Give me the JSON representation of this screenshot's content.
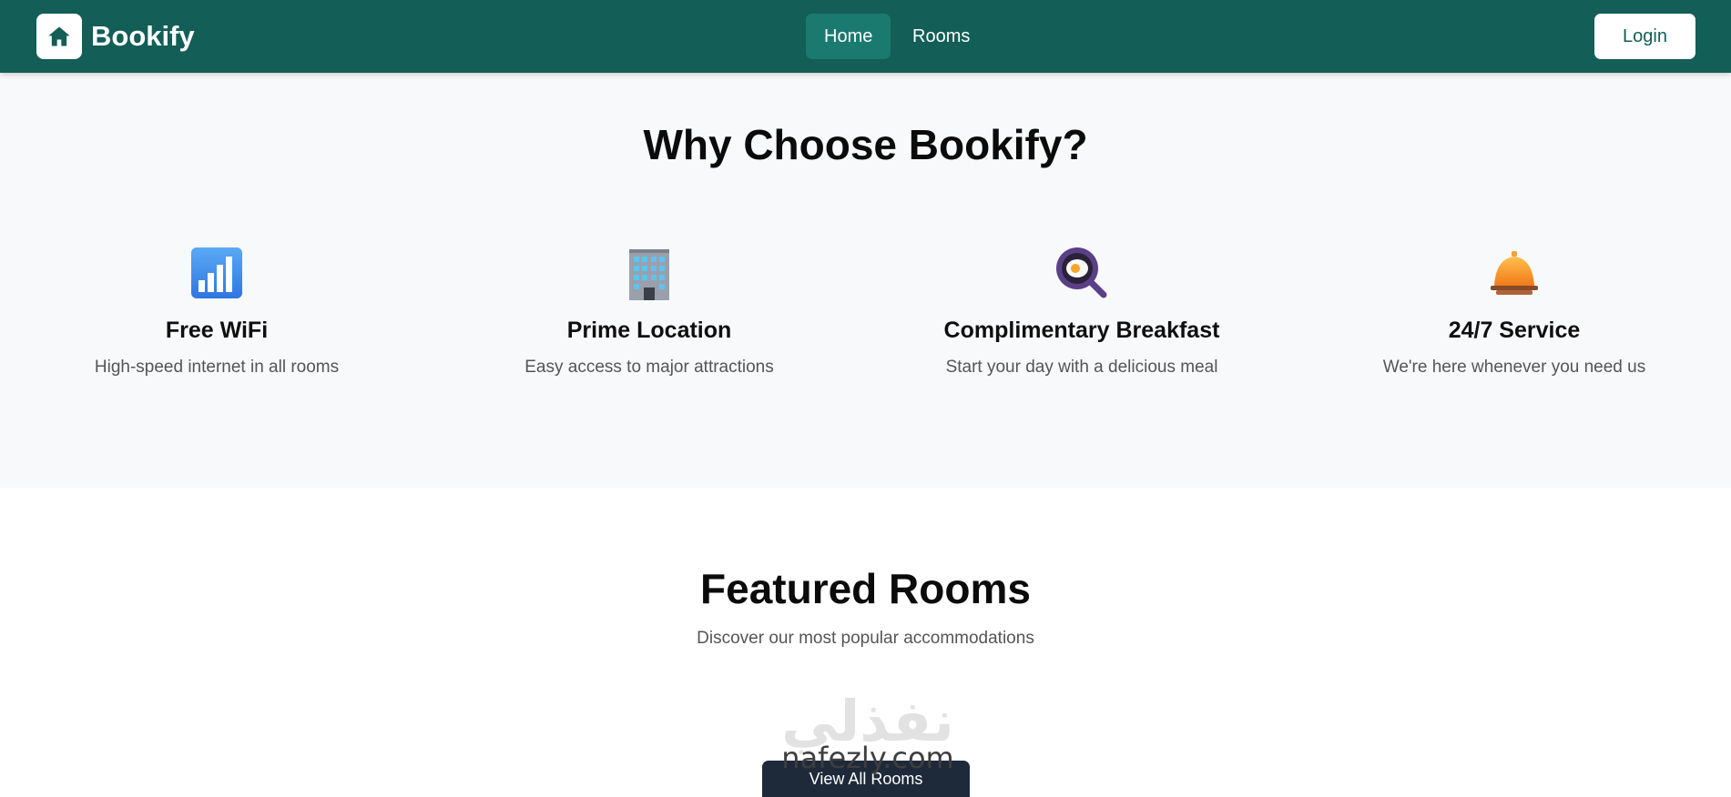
{
  "nav": {
    "brand": "Bookify",
    "links": [
      "Home",
      "Rooms"
    ],
    "active_link": "Home",
    "login": "Login"
  },
  "why": {
    "title": "Why Choose Bookify?",
    "features": [
      {
        "icon": "signal-bars-icon",
        "title": "Free WiFi",
        "desc": "High-speed internet in all rooms"
      },
      {
        "icon": "office-building-icon",
        "title": "Prime Location",
        "desc": "Easy access to major attractions"
      },
      {
        "icon": "frying-pan-egg-icon",
        "title": "Complimentary Breakfast",
        "desc": "Start your day with a delicious meal"
      },
      {
        "icon": "bellhop-bell-icon",
        "title": "24/7 Service",
        "desc": "We're here whenever you need us"
      }
    ]
  },
  "featured": {
    "title": "Featured Rooms",
    "subtitle": "Discover our most popular accommodations",
    "button": "View All Rooms"
  },
  "watermark": {
    "arabic": "نفذلي",
    "latin": "nafezly.com"
  },
  "colors": {
    "primary": "#135e57",
    "active_link_bg": "#1b7a70",
    "section_bg": "#f7f9fb",
    "button_dark": "#1e2a3a"
  }
}
